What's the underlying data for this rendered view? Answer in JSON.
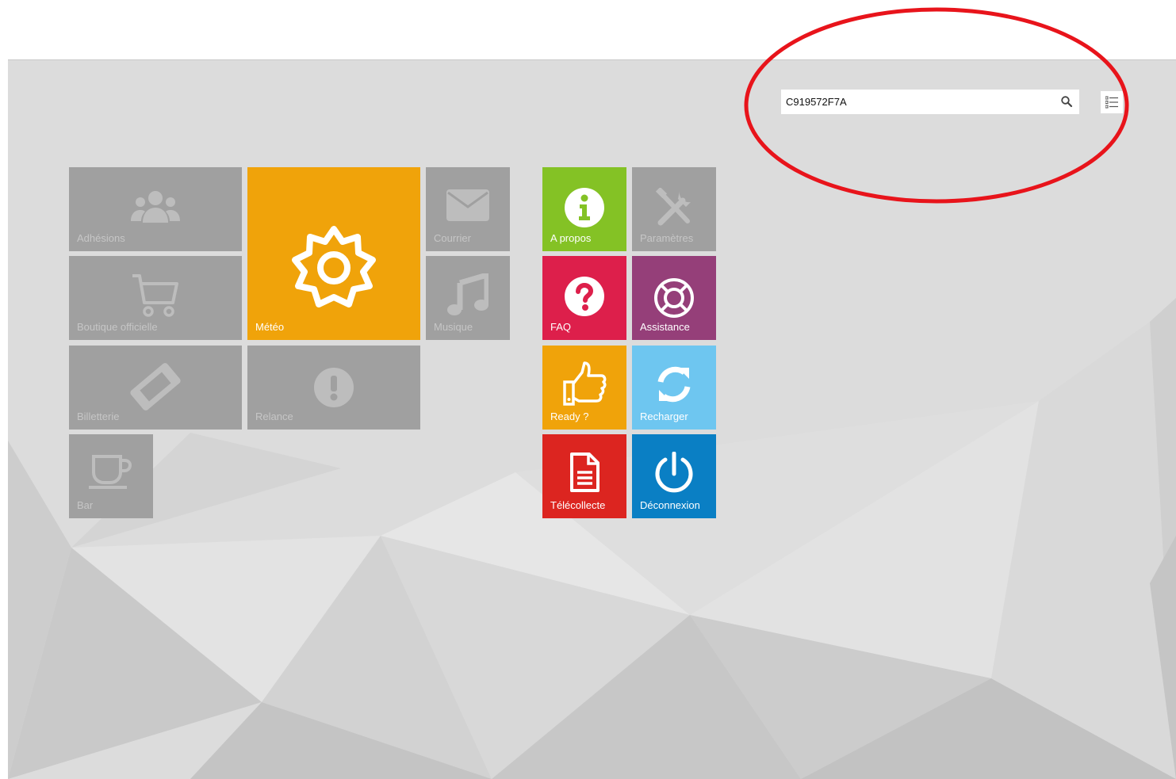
{
  "search": {
    "value": "C919572F7A"
  },
  "icons": {
    "search": "search-icon",
    "list": "list-view-icon"
  },
  "tiles": [
    {
      "id": "adhesions",
      "label": "Adhésions",
      "color": "#a0a0a0",
      "icon": "users-icon",
      "enabled": false
    },
    {
      "id": "meteo",
      "label": "Météo",
      "color": "#f0a30a",
      "icon": "sun-gear-icon",
      "enabled": true
    },
    {
      "id": "courrier",
      "label": "Courrier",
      "color": "#a0a0a0",
      "icon": "envelope-icon",
      "enabled": false
    },
    {
      "id": "boutique",
      "label": "Boutique officielle",
      "color": "#a0a0a0",
      "icon": "cart-icon",
      "enabled": false
    },
    {
      "id": "musique",
      "label": "Musique",
      "color": "#a0a0a0",
      "icon": "music-note-icon",
      "enabled": false
    },
    {
      "id": "billetterie",
      "label": "Billetterie",
      "color": "#a0a0a0",
      "icon": "ticket-icon",
      "enabled": false
    },
    {
      "id": "relance",
      "label": "Relance",
      "color": "#a0a0a0",
      "icon": "exclamation-icon",
      "enabled": false
    },
    {
      "id": "bar",
      "label": "Bar",
      "color": "#a0a0a0",
      "icon": "cup-icon",
      "enabled": false
    },
    {
      "id": "apropos",
      "label": "A propos",
      "color": "#84c225",
      "icon": "info-icon",
      "enabled": true
    },
    {
      "id": "parametres",
      "label": "Paramètres",
      "color": "#a0a0a0",
      "icon": "tools-icon",
      "enabled": false
    },
    {
      "id": "faq",
      "label": "FAQ",
      "color": "#dd1f4b",
      "icon": "question-icon",
      "enabled": true
    },
    {
      "id": "assistance",
      "label": "Assistance",
      "color": "#953f79",
      "icon": "lifebuoy-icon",
      "enabled": true
    },
    {
      "id": "ready",
      "label": "Ready ?",
      "color": "#f0a30a",
      "icon": "thumbs-up-icon",
      "enabled": true
    },
    {
      "id": "recharger",
      "label": "Recharger",
      "color": "#6ec6f0",
      "icon": "refresh-icon",
      "enabled": true
    },
    {
      "id": "telecollecte",
      "label": "Télécollecte",
      "color": "#dc2520",
      "icon": "document-icon",
      "enabled": true
    },
    {
      "id": "deconnexion",
      "label": "Déconnexion",
      "color": "#0a7fc4",
      "icon": "power-icon",
      "enabled": true
    }
  ],
  "annotation": {
    "color": "#e8141b"
  }
}
